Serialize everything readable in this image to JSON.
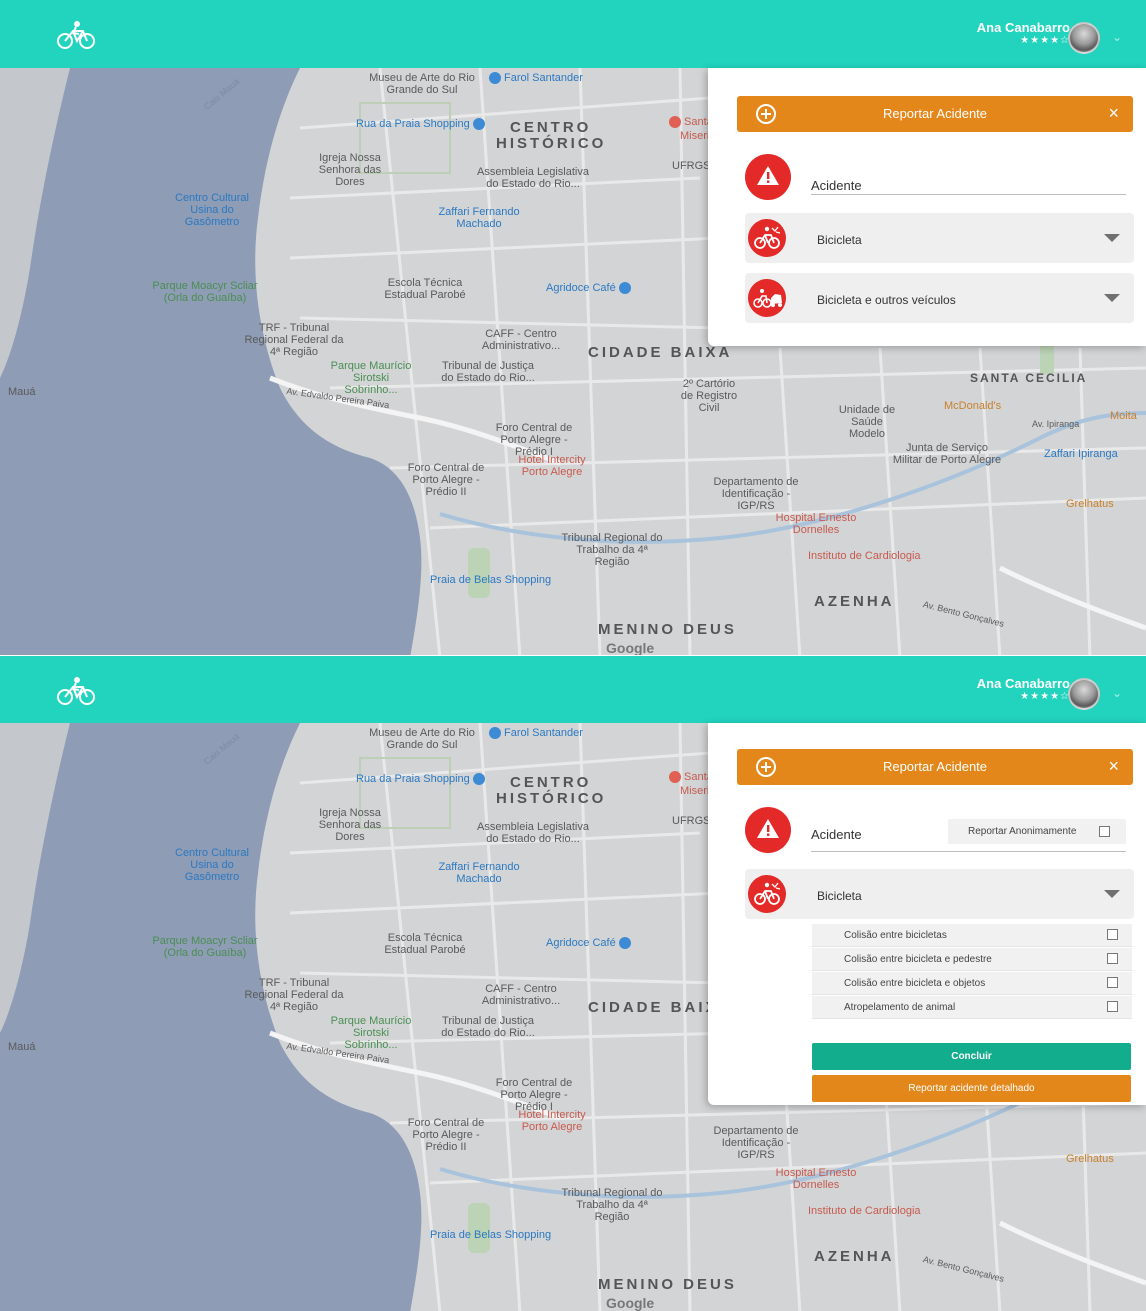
{
  "app": {
    "logo_icon": "bicycle-icon",
    "brand_color": "#22d3bd",
    "accent_color": "#e4871b",
    "alert_color": "#e32a28",
    "confirm_color": "#12ad8d"
  },
  "user": {
    "name": "Ana Canabarro",
    "rating_stars": "★★★★☆",
    "rating_value": 4,
    "rating_max": 5,
    "menu_icon": "chevron-down-icon"
  },
  "map": {
    "labels": {
      "museu": "Museu de Arte do Rio Grande do Sul",
      "farol": "Farol Santander",
      "rua_praia": "Rua da Praia Shopping",
      "centro": "CENTRO",
      "historico": "HISTÓRICO",
      "santa": "Santa",
      "miseri": "Miseri",
      "igreja": "Igreja Nossa Senhora das Dores",
      "assembleia": "Assembleia Legislativa do Estado do Rio...",
      "ufrgs": "UFRGS",
      "usina": "Centro Cultural Usina do Gasômetro",
      "zaffari": "Zaffari Fernando Machado",
      "escola": "Escola Técnica Estadual Parobé",
      "agridoce": "Agridoce Café",
      "parque_moacyr": "Parque Moacyr Scliar (Orla do Guaíba)",
      "trf": "TRF - Tribunal Regional Federal da 4ª Região",
      "caff": "CAFF - Centro Administrativo...",
      "cidade_baixa": "CIDADE BAIXA",
      "parque_mauricio": "Parque Maurício Sirotski Sobrinho...",
      "tribunal_justica": "Tribunal de Justiça do Estado do Rio...",
      "cartorio": "2º Cartório de Registro Civil",
      "santa_cecilia": "SANTA CECILIA",
      "maua": "Mauá",
      "edvaldo": "Av. Edvaldo Pereira Paiva",
      "unidade": "Unidade de Saúde Modelo",
      "mcdonalds": "McDonald's",
      "moita": "Moita",
      "ipiranga": "Av. Ipiranga",
      "foro1": "Foro Central de Porto Alegre - Prédio I",
      "junta": "Junta de Serviço Militar de Porto Alegre",
      "zaffari_ipiranga": "Zaffari Ipiranga",
      "hotel": "Hotel Intercity Porto Alegre",
      "foro2": "Foro Central de Porto Alegre - Prédio II",
      "departamento": "Departamento de Identificação - IGP/RS",
      "grelhatus": "Grelhatus",
      "hospital": "Hospital Ernesto Dornelles",
      "tribunal_trabalho": "Tribunal Regional do Trabalho da 4ª Região",
      "instituto": "Instituto de Cardiologia",
      "praia_belas": "Praia de Belas Shopping",
      "azenha": "AZENHA",
      "bento": "Av. Bento Gonçalves",
      "menino_deus": "MENINO DEUS",
      "google": "Google",
      "cais": "Cais Mauá"
    }
  },
  "screen1": {
    "panel": {
      "header_icon": "plus-circle-icon",
      "title": "Reportar Acidente",
      "close": "×",
      "accident_icon": "warning-icon",
      "accident_label": "Acidente",
      "categories": [
        {
          "label": "Bicicleta",
          "icon": "bicycle-crash-icon"
        },
        {
          "label": "Bicicleta e outros veículos",
          "icon": "bicycle-car-crash-icon"
        }
      ]
    }
  },
  "screen2": {
    "panel": {
      "header_icon": "plus-circle-icon",
      "title": "Reportar Acidente",
      "close": "×",
      "accident_icon": "warning-icon",
      "accident_label": "Acidente",
      "anonymous_label": "Reportar Anonimamente",
      "category": {
        "label": "Bicicleta",
        "icon": "bicycle-crash-icon"
      },
      "options": [
        "Colisão entre bicicletas",
        "Colisão entre bicicleta e pedestre",
        "Colisão entre bicicleta e objetos",
        "Atropelamento de animal"
      ],
      "confirm_button": "Concluir",
      "detailed_button": "Reportar acidente detalhado"
    }
  }
}
